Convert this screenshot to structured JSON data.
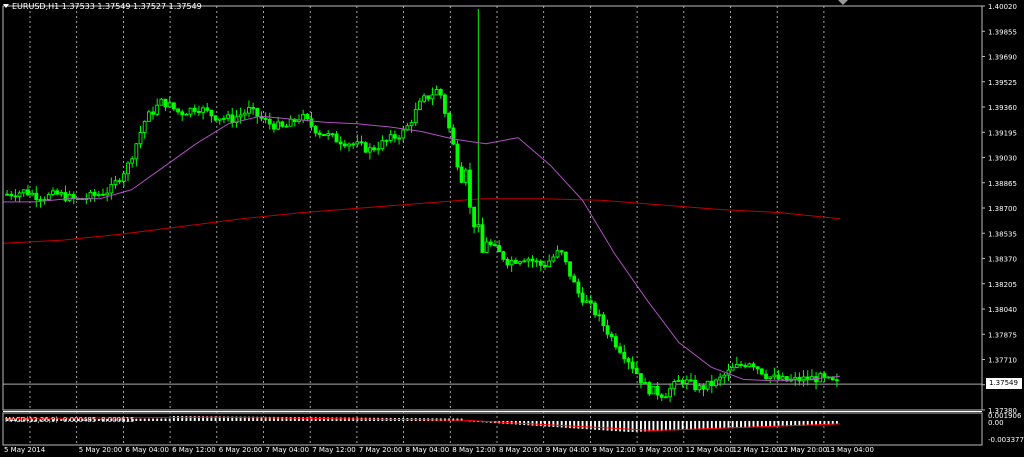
{
  "chart_title": "EURUSD,H1  1.37533 1.37549 1.37527 1.37549",
  "macd_label": "MACD(12,26,9) -0.000485 -0.000615",
  "current_price_label": "1.37549",
  "colors": {
    "background": "#000000",
    "candle": "#00ff00",
    "fast_ma": "#b050c0",
    "slow_ma": "#c00000",
    "grid": "#ffffff",
    "macd_histogram": "#ffffff",
    "macd_signal": "#ff0000"
  },
  "chart_data": [
    {
      "type": "candlestick",
      "symbol": "EURUSD",
      "timeframe": "H1",
      "y_ticks": [
        "1.40020",
        "1.39855",
        "1.39690",
        "1.39525",
        "1.39360",
        "1.39195",
        "1.39030",
        "1.38865",
        "1.38700",
        "1.38535",
        "1.38370",
        "1.38205",
        "1.38040",
        "1.37875",
        "1.37710",
        "1.37545",
        "1.37380"
      ],
      "x_ticks": [
        "5 May 2014",
        "5 May 20:00",
        "6 May 04:00",
        "6 May 12:00",
        "6 May 20:00",
        "7 May 04:00",
        "7 May 12:00",
        "7 May 20:00",
        "8 May 04:00",
        "8 May 12:00",
        "8 May 20:00",
        "9 May 04:00",
        "9 May 12:00",
        "9 May 20:00",
        "12 May 04:00",
        "12 May 12:00",
        "12 May 20:00",
        "13 May 04:00"
      ],
      "ylim": [
        1.3738,
        1.4002
      ],
      "grid": "vertical dotted",
      "current_price": 1.37549,
      "close_path": [
        1.3879,
        1.3881,
        1.3877,
        1.3879,
        1.3875,
        1.3878,
        1.3882,
        1.3898,
        1.3928,
        1.394,
        1.3932,
        1.3936,
        1.393,
        1.3928,
        1.3934,
        1.3926,
        1.3922,
        1.393,
        1.392,
        1.3915,
        1.3912,
        1.3908,
        1.3914,
        1.392,
        1.394,
        1.3948,
        1.3902,
        1.386,
        1.3845,
        1.3835,
        1.3838,
        1.3832,
        1.3842,
        1.3815,
        1.3802,
        1.3785,
        1.377,
        1.3752,
        1.3748,
        1.3758,
        1.3752,
        1.3756,
        1.3765,
        1.377,
        1.376,
        1.3757,
        1.3758,
        1.3759,
        1.3755
      ],
      "fast_ma_path": [
        1.3874,
        1.3874,
        1.3876,
        1.3876,
        1.3882,
        1.3897,
        1.3912,
        1.3925,
        1.393,
        1.3928,
        1.3926,
        1.3925,
        1.3923,
        1.392,
        1.3915,
        1.3912,
        1.3916,
        1.3898,
        1.3875,
        1.384,
        1.381,
        1.3782,
        1.3766,
        1.3758,
        1.3757,
        1.3758,
        1.376
      ],
      "slow_ma_path": [
        1.3847,
        1.3849,
        1.3853,
        1.3858,
        1.3863,
        1.3867,
        1.387,
        1.3873,
        1.3876,
        1.3876,
        1.3875,
        1.3872,
        1.3869,
        1.3867,
        1.3863
      ]
    },
    {
      "type": "bar",
      "indicator": "MACD(12,26,9)",
      "y_ticks": [
        "0.001906",
        "0.00",
        "-0.003377"
      ],
      "macd": -0.000485,
      "signal": -0.000615
    }
  ]
}
